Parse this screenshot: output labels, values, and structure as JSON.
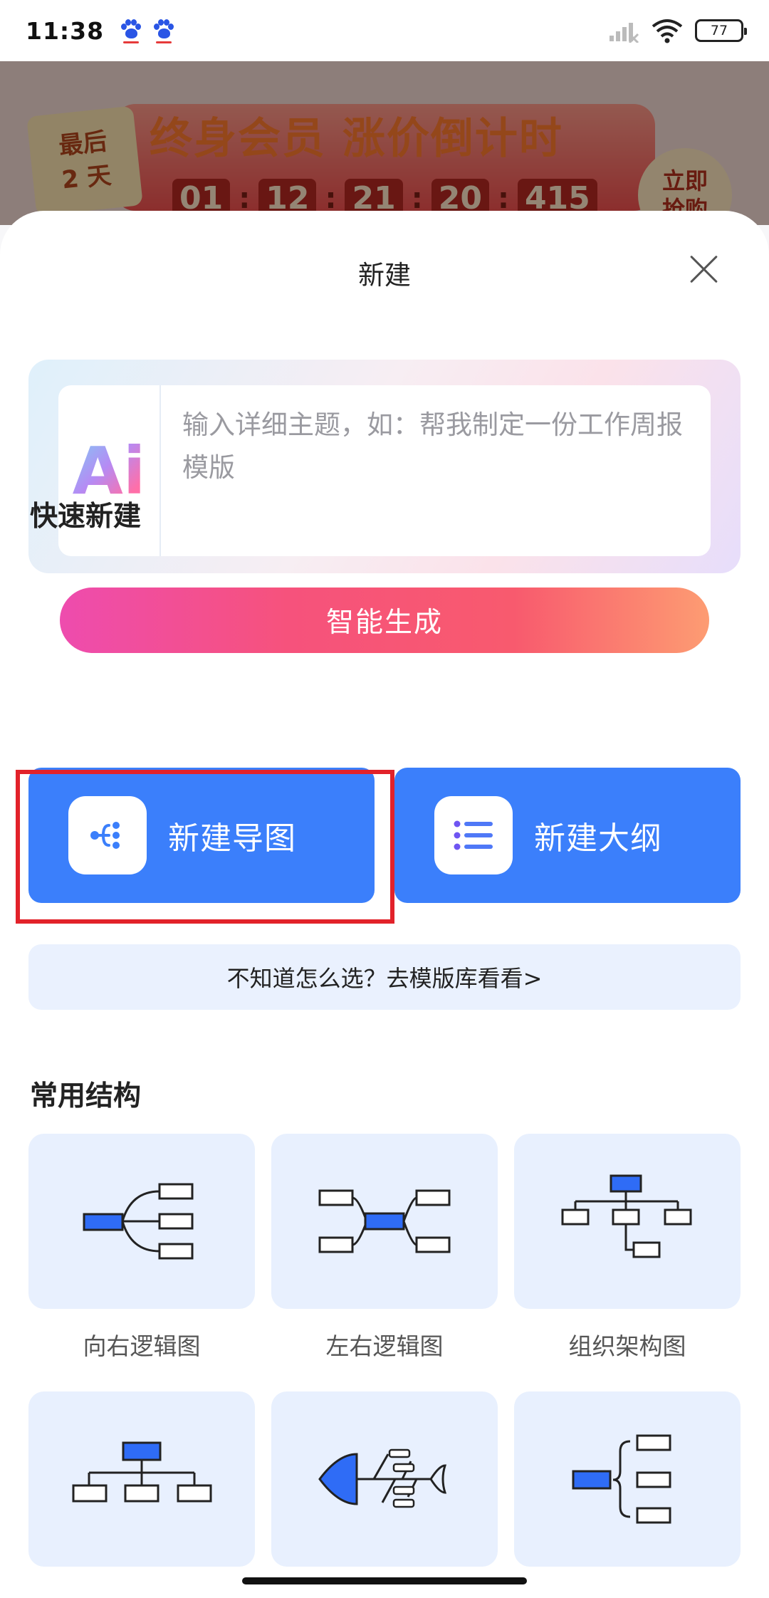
{
  "status_bar": {
    "time": "11:38",
    "battery": "77"
  },
  "promo": {
    "tag_line1": "最后",
    "tag_line2": "2 天",
    "title": "终身会员 涨价倒计时",
    "countdown": [
      "01",
      "12",
      "21",
      "20",
      "415"
    ],
    "separator": ":",
    "buy_line1": "立即",
    "buy_line2": "抢购"
  },
  "sheet": {
    "title": "新建"
  },
  "ai": {
    "logo_text": "Ai",
    "placeholder": "输入详细主题，如：帮我制定一份工作周报模版",
    "generate_label": "智能生成"
  },
  "quick": {
    "section_title": "快速新建",
    "new_mindmap_label": "新建导图",
    "new_outline_label": "新建大纲",
    "template_link": "不知道怎么选？去模版库看看>"
  },
  "structures": {
    "section_title": "常用结构",
    "items": [
      {
        "label": "向右逻辑图",
        "icon": "right-logic-icon"
      },
      {
        "label": "左右逻辑图",
        "icon": "left-right-logic-icon"
      },
      {
        "label": "组织架构图",
        "icon": "org-chart-icon"
      },
      {
        "label": "",
        "icon": "tree-chart-icon"
      },
      {
        "label": "",
        "icon": "fishbone-icon"
      },
      {
        "label": "",
        "icon": "bracket-icon"
      }
    ]
  },
  "colors": {
    "accent_blue": "#3b7ffb",
    "node_blue": "#2f6cf6",
    "highlight_red": "#e2222a"
  }
}
